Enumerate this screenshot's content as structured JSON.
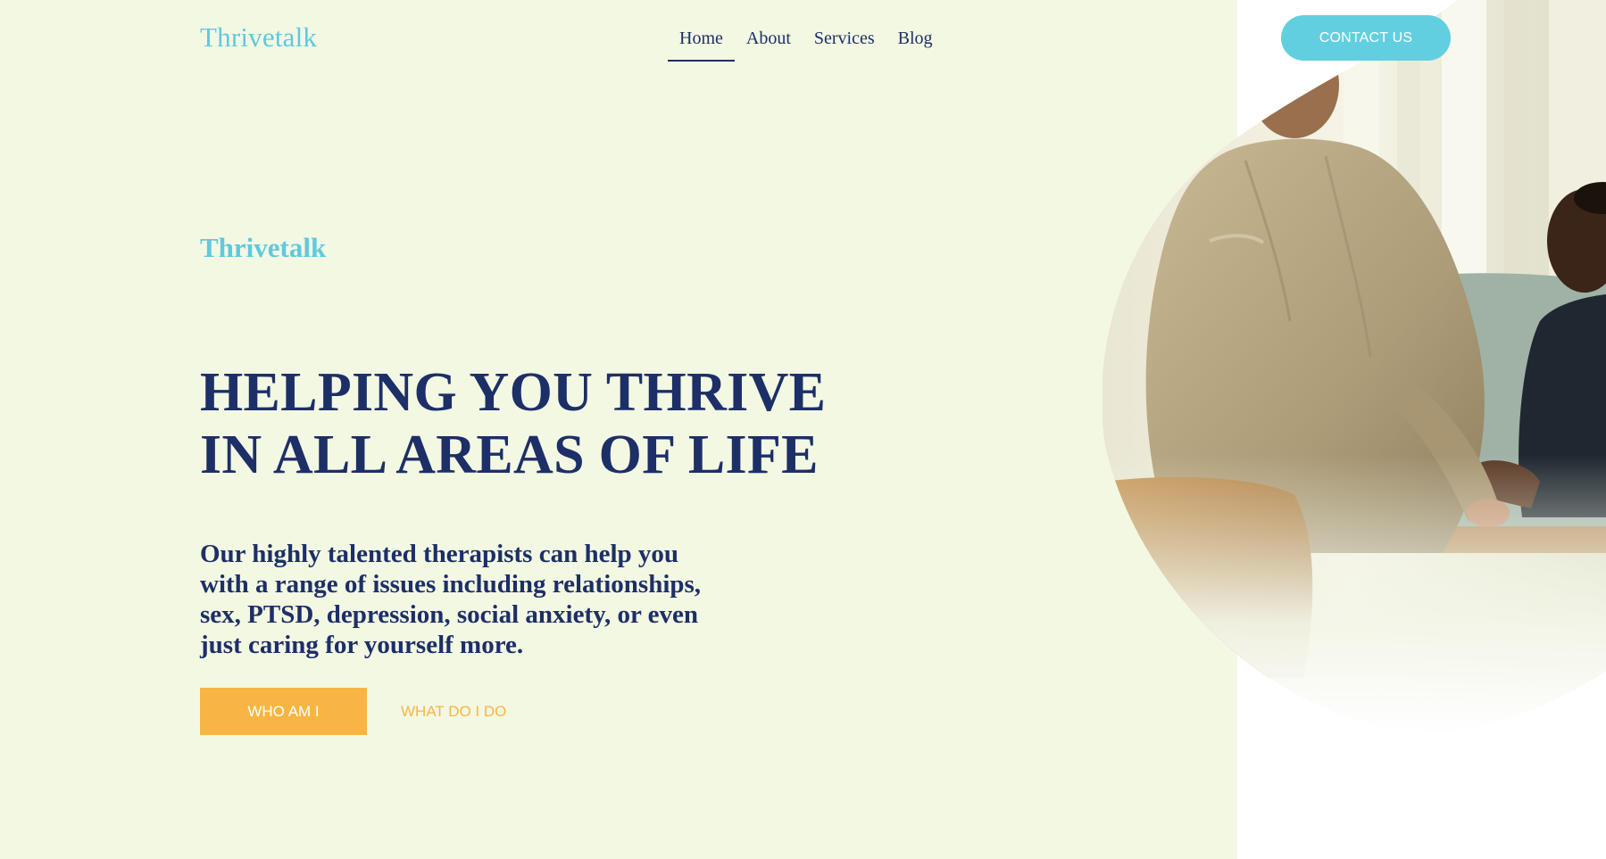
{
  "header": {
    "logo": "Thrivetalk",
    "nav": [
      {
        "label": "Home",
        "active": true
      },
      {
        "label": "About",
        "active": false
      },
      {
        "label": "Services",
        "active": false
      },
      {
        "label": "Blog",
        "active": false
      }
    ],
    "contact_label": "CONTACT US"
  },
  "hero": {
    "eyebrow": "Thrivetalk",
    "headline_lines": [
      "HELPING YOU THRIVE",
      "IN ALL AREAS OF LIFE"
    ],
    "subtext_lines": [
      "Our highly talented therapists can help you",
      "with a range of issues including relationships,",
      "sex, PTSD, depression, social anxiety, or even",
      "just caring for yourself more."
    ],
    "primary_button": "WHO AM I",
    "secondary_button": "WHAT DO I DO",
    "image_icon": "therapy-session-photo"
  },
  "colors": {
    "background": "#f3f8e3",
    "accent_teal": "#5fc9de",
    "navy": "#1d2f67",
    "accent_orange": "#f8b543"
  }
}
